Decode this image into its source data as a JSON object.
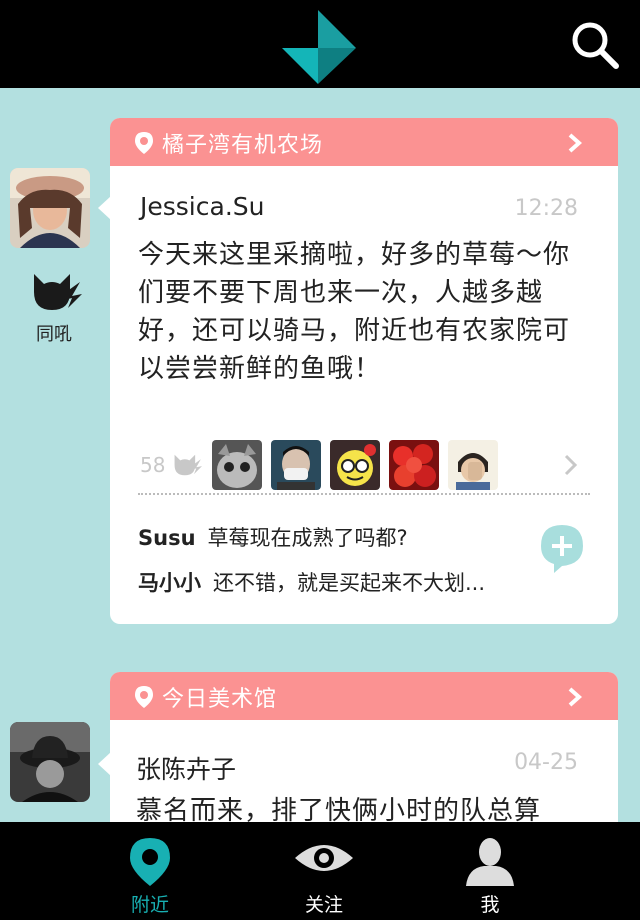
{
  "header": {
    "logo": "app-logo",
    "search_icon": "search-icon"
  },
  "posts": [
    {
      "location": "橘子湾有机农场",
      "author": "Jessica.Su",
      "time": "12:28",
      "text": "今天来这里采摘啦，好多的草莓～你们要不要下周也来一次，人越多越好，还可以骑马，附近也有农家院可以尝尝新鲜的鱼哦！",
      "roar_label": "同吼",
      "like_count": "58",
      "comments": [
        {
          "name": "Susu",
          "text": "草莓现在成熟了吗都?"
        },
        {
          "name": "马小小",
          "text": "还不错，就是买起来不大划..."
        }
      ]
    },
    {
      "location": "今日美术馆",
      "author": "张陈卉子",
      "time": "04-25",
      "text": "慕名而来，排了快俩小时的队总算"
    }
  ],
  "tabs": [
    {
      "label": "附近",
      "icon": "location-pin-icon",
      "active": true
    },
    {
      "label": "关注",
      "icon": "eye-icon",
      "active": false
    },
    {
      "label": "我",
      "icon": "person-icon",
      "active": false
    }
  ],
  "colors": {
    "accent": "#18b0b3",
    "card_header": "#fb9292",
    "background": "#b3e0e0"
  }
}
